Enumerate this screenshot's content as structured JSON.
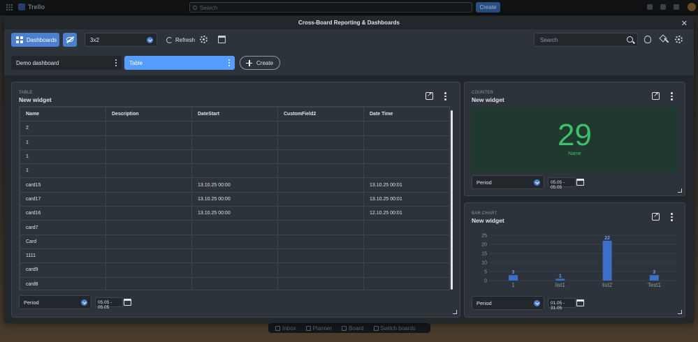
{
  "background_app": {
    "app_name": "Trello",
    "search_placeholder": "Search",
    "create_label": "Create",
    "bottom_nav": [
      "Inbox",
      "Planner",
      "Board",
      "Switch boards"
    ]
  },
  "modal": {
    "title": "Cross-Board Reporting & Dashboards"
  },
  "toolbar": {
    "dashboards_label": "Dashboards",
    "layout_value": "3x2",
    "refresh_label": "Refresh",
    "search_placeholder": "Search"
  },
  "tabs": {
    "items": [
      {
        "label": "Demo dashboard"
      },
      {
        "label": "Table"
      }
    ],
    "create_label": "Create"
  },
  "table_widget": {
    "type_label": "TABLE",
    "title": "New widget",
    "columns": [
      "Name",
      "Description",
      "DateStart",
      "CustomField2",
      "Date Time"
    ],
    "rows": [
      [
        "2",
        "",
        "",
        "",
        ""
      ],
      [
        "1",
        "",
        "",
        "",
        ""
      ],
      [
        "1",
        "",
        "",
        "",
        ""
      ],
      [
        "1",
        "",
        "",
        "",
        ""
      ],
      [
        "card15",
        "",
        "13.10.25 00:00",
        "",
        "13.10.25 00:01"
      ],
      [
        "card17",
        "",
        "13.10.25 00:00",
        "",
        "13.10.25 00:01"
      ],
      [
        "card16",
        "",
        "13.10.25 00:00",
        "",
        "12.10.25 00:01"
      ],
      [
        "card7",
        "",
        "",
        "",
        ""
      ],
      [
        "Card",
        "",
        "",
        "",
        ""
      ],
      [
        "1111",
        "",
        "",
        "",
        ""
      ],
      [
        "card9",
        "",
        "",
        "",
        ""
      ],
      [
        "card8",
        "",
        "",
        "",
        ""
      ]
    ],
    "period_label": "Period",
    "date_range": "05.05 - 05.05"
  },
  "counter_widget": {
    "type_label": "COUNTER",
    "title": "New widget",
    "value": "29",
    "value_label": "Name",
    "period_label": "Period",
    "date_range": "05.05 - 05.05",
    "colors": {
      "value": "#3ec06a",
      "panel": "#20392f"
    }
  },
  "bar_widget": {
    "type_label": "BAR CHART",
    "title": "New widget",
    "period_label": "Period",
    "date_range": "01.05 - 31.05"
  },
  "chart_data": {
    "type": "bar",
    "categories": [
      "1",
      "list1",
      "list2",
      "Test1"
    ],
    "values": [
      3,
      1,
      22,
      3
    ],
    "yticks": [
      0,
      5,
      10,
      15,
      20,
      25
    ],
    "ylim": [
      0,
      25
    ],
    "grid": true,
    "color": "#3c6fc8"
  }
}
